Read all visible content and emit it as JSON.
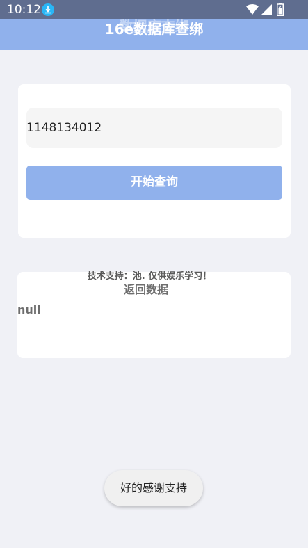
{
  "status_bar": {
    "time": "10:12",
    "icons": [
      "download-icon",
      "wifi-icon",
      "signal-icon",
      "battery-icon"
    ]
  },
  "app_bar": {
    "title": "16e数据库查绑",
    "ghost_title": "数据库查绑"
  },
  "query": {
    "input_value": "1148134012",
    "button_label": "开始查询"
  },
  "support_text": "技术支持：池. 仅供娱乐学习！",
  "result": {
    "title": "返回数据",
    "value": "null"
  },
  "toast": {
    "text": "好的感谢支持"
  },
  "colors": {
    "accent": "#90b1ec",
    "status_bar": "#5f6d8f",
    "background": "#f0f1f6"
  }
}
